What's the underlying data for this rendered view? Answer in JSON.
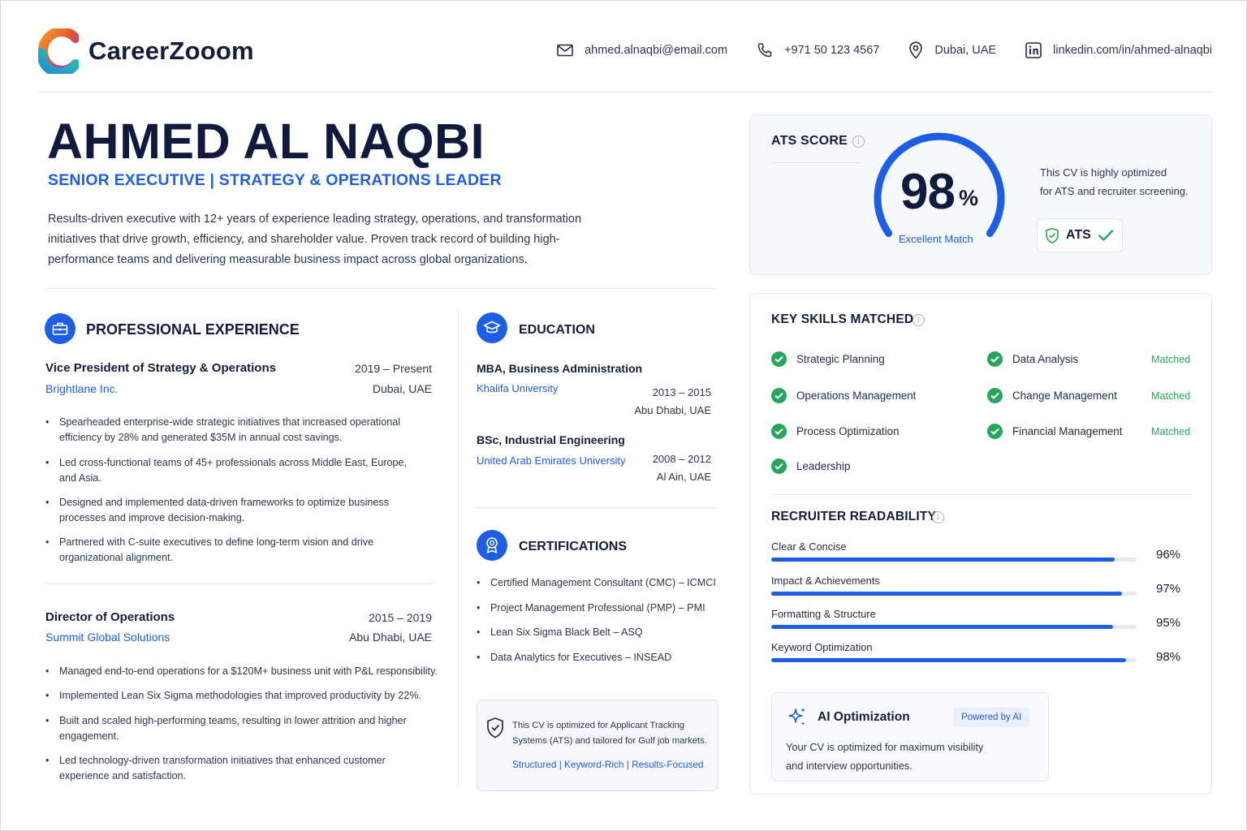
{
  "brand": {
    "name": "CareerZooom"
  },
  "contact": {
    "email": "ahmed.alnaqbi@email.com",
    "phone": "+971 50 123 4567",
    "location": "Dubai, UAE",
    "linkedin": "linkedin.com/in/ahmed-alnaqbi"
  },
  "profile": {
    "name": "AHMED AL NAQBI",
    "title": "SENIOR EXECUTIVE | STRATEGY & OPERATIONS LEADER",
    "summary_lines": [
      "Results-driven executive with 12+ years of experience leading strategy, operations, and transformation",
      "initiatives that drive growth, efficiency, and shareholder value. Proven track record of building high-",
      "performance teams and delivering measurable business impact across global organizations."
    ]
  },
  "experience": {
    "heading": "PROFESSIONAL EXPERIENCE",
    "jobs": [
      {
        "title": "Vice President of Strategy & Operations",
        "company": "Brightlane Inc.",
        "dates": "2019 – Present",
        "location": "Dubai, UAE",
        "bullets": [
          [
            "Spearheaded enterprise-wide strategic initiatives that increased operational",
            "efficiency by 28% and generated $35M in annual cost savings."
          ],
          [
            "Led cross-functional teams of 45+ professionals across Middle East, Europe,",
            "and Asia."
          ],
          [
            "Designed and implemented data-driven frameworks to optimize business",
            "processes and improve decision-making."
          ],
          [
            "Partnered with C-suite executives to define long-term vision and drive",
            "organizational alignment."
          ]
        ]
      },
      {
        "title": "Director of Operations",
        "company": "Summit Global Solutions",
        "dates": "2015 – 2019",
        "location": "Abu Dhabi, UAE",
        "bullets": [
          [
            "Managed end-to-end operations for a $120M+ business unit with P&L responsibility."
          ],
          [
            "Implemented Lean Six Sigma methodologies that improved productivity by 22%."
          ],
          [
            "Built and scaled high-performing teams, resulting in lower attrition and higher",
            "engagement."
          ],
          [
            "Led technology-driven transformation initiatives that enhanced customer",
            "experience and satisfaction."
          ]
        ]
      }
    ]
  },
  "education": {
    "heading": "EDUCATION",
    "items": [
      {
        "degree": "MBA, Business Administration",
        "school": "Khalifa University",
        "dates": "2013 – 2015",
        "location": "Abu Dhabi, UAE"
      },
      {
        "degree": "BSc, Industrial Engineering",
        "school": "United Arab Emirates University",
        "dates": "2008 – 2012",
        "location": "Al Ain, UAE"
      }
    ]
  },
  "certifications": {
    "heading": "CERTIFICATIONS",
    "items": [
      "Certified Management Consultant (CMC) – ICMCI",
      "Project Management Professional (PMP) – PMI",
      "Lean Six Sigma Black Belt – ASQ",
      "Data Analytics for Executives – INSEAD"
    ]
  },
  "ats_note": {
    "lines": [
      "This CV is optimized for Applicant Tracking",
      "Systems (ATS) and tailored for Gulf job markets."
    ],
    "tags": "Structured | Keyword-Rich | Results-Focused"
  },
  "ats": {
    "label": "ATS SCORE",
    "score": "98",
    "score_value": 98,
    "unit": "%",
    "match": "Excellent Match",
    "desc_lines": [
      "This CV is highly optimized",
      "for ATS and recruiter screening."
    ],
    "badge": "ATS",
    "accent": "#1d5ee6"
  },
  "skills": {
    "label": "KEY SKILLS MATCHED",
    "left": [
      "Strategic Planning",
      "Operations Management",
      "Process Optimization",
      "Leadership"
    ],
    "right": [
      "Data Analysis",
      "Change Management",
      "Financial Management"
    ],
    "matched_label": "Matched",
    "check_color": "#27a55a"
  },
  "readability": {
    "label": "RECRUITER READABILITY",
    "items": [
      {
        "label": "Clear & Concise",
        "value": "96%",
        "fraction": 0.94
      },
      {
        "label": "Impact & Achievements",
        "value": "97%",
        "fraction": 0.96
      },
      {
        "label": "Formatting & Structure",
        "value": "95%",
        "fraction": 0.935
      },
      {
        "label": "Keyword Optimization",
        "value": "98%",
        "fraction": 0.97
      }
    ]
  },
  "ai": {
    "title": "AI Optimization",
    "badge": "Powered by AI",
    "lines": [
      "Your CV is optimized for maximum visibility",
      "and interview opportunities."
    ]
  }
}
